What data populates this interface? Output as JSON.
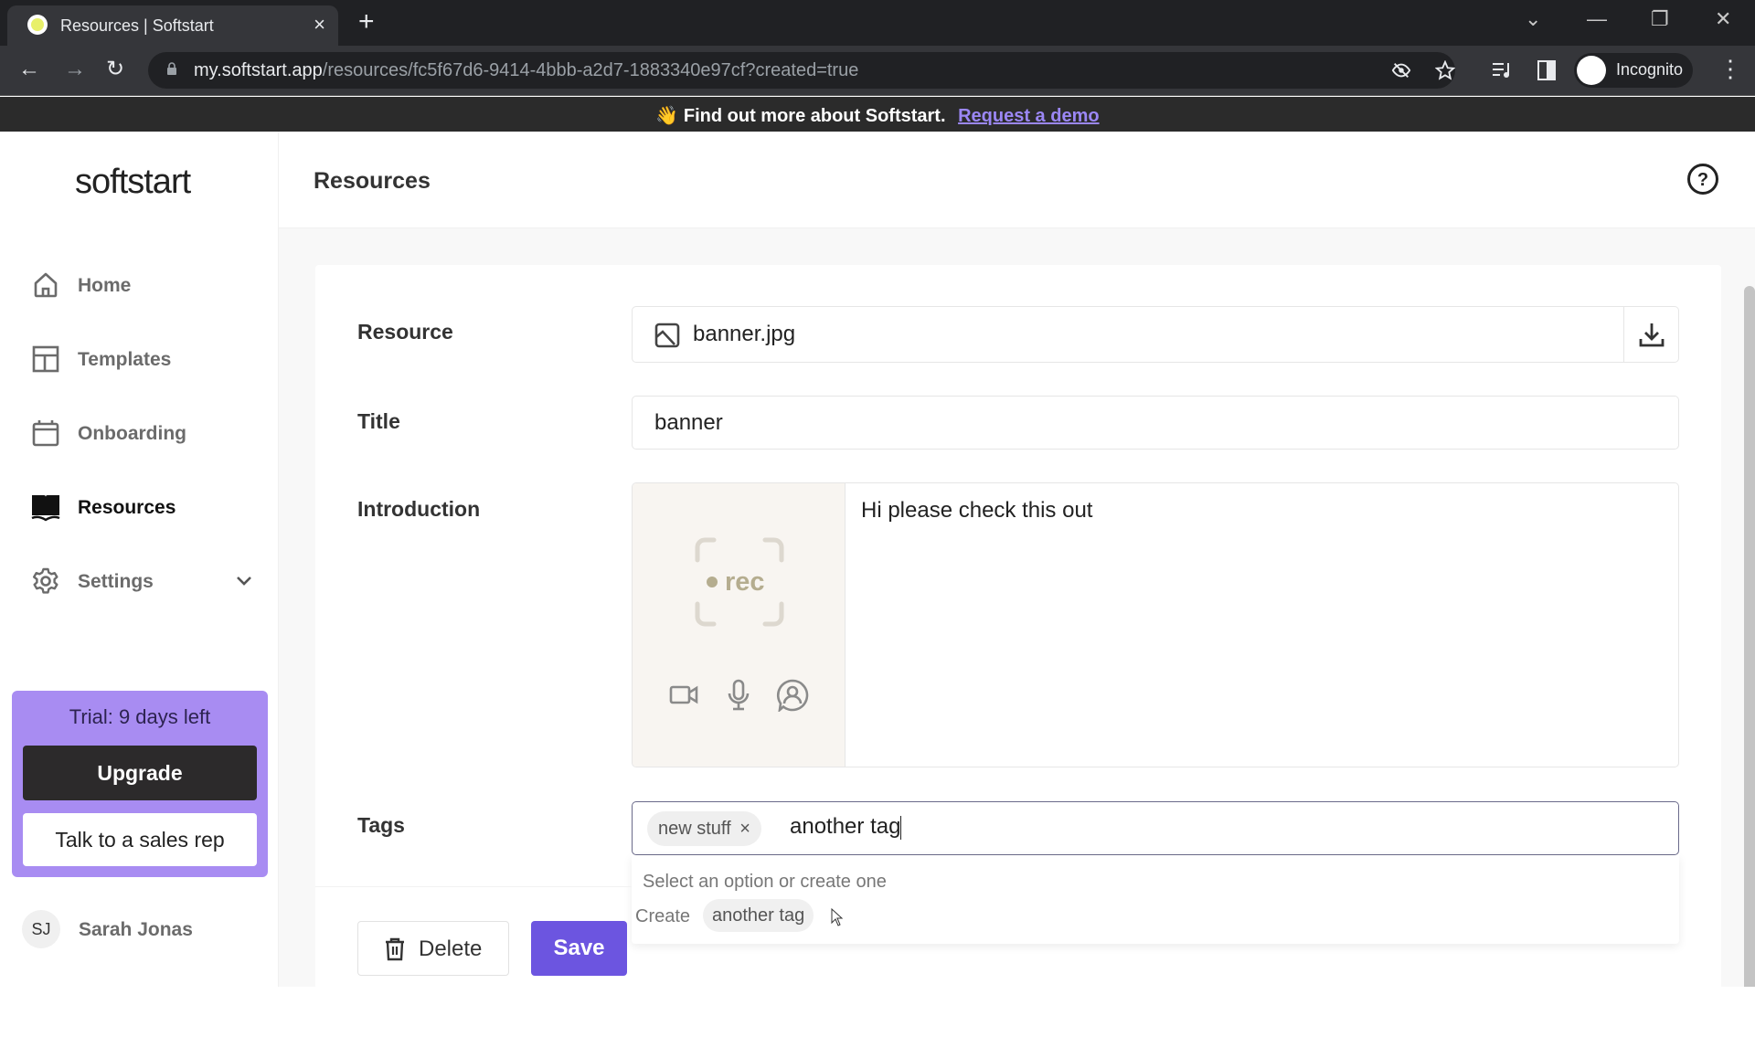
{
  "browser": {
    "tab_title": "Resources | Softstart",
    "tab_close": "×",
    "new_tab": "+",
    "url_host": "my.softstart.app",
    "url_path": "/resources/fc5f67d6-9414-4bbb-a2d7-1883340e97cf?created=true",
    "profile_label": "Incognito",
    "window_controls": {
      "tabsearch": "⌄",
      "minimize": "—",
      "restore": "❐",
      "close": "✕"
    },
    "nav": {
      "back": "←",
      "forward": "→",
      "reload": "↻"
    }
  },
  "promo": {
    "emoji": "👋",
    "text": "Find out more about Softstart.",
    "link": "Request a demo"
  },
  "sidebar": {
    "logo": "softstart",
    "items": [
      {
        "label": "Home",
        "icon": "home-icon",
        "active": false
      },
      {
        "label": "Templates",
        "icon": "layout-icon",
        "active": false
      },
      {
        "label": "Onboarding",
        "icon": "calendar-icon",
        "active": false
      },
      {
        "label": "Resources",
        "icon": "book-icon",
        "active": true
      },
      {
        "label": "Settings",
        "icon": "gear-icon",
        "active": false,
        "expandable": true
      }
    ],
    "trial": {
      "text": "Trial: 9 days left",
      "upgrade_label": "Upgrade",
      "sales_label": "Talk to a sales rep"
    },
    "user": {
      "initials": "SJ",
      "name": "Sarah Jonas"
    }
  },
  "header": {
    "title": "Resources",
    "help_icon": "help-circle-icon"
  },
  "form": {
    "resource": {
      "label": "Resource",
      "value": "banner.jpg"
    },
    "title": {
      "label": "Title",
      "value": "banner"
    },
    "introduction": {
      "label": "Introduction",
      "value": "Hi please check this out",
      "rec_label": "rec"
    },
    "tags": {
      "label": "Tags",
      "chips": [
        {
          "text": "new stuff",
          "remove": "×"
        }
      ],
      "input_value": "another tag",
      "dropdown_hint": "Select an option or create one",
      "create_label": "Create",
      "create_value": "another tag"
    },
    "delete_label": "Delete",
    "save_label": "Save"
  },
  "colors": {
    "accent": "#6c55e0",
    "trial_bg": "#a88cf2",
    "promo_link": "#9b87f5",
    "dark": "#2c2a2b"
  }
}
